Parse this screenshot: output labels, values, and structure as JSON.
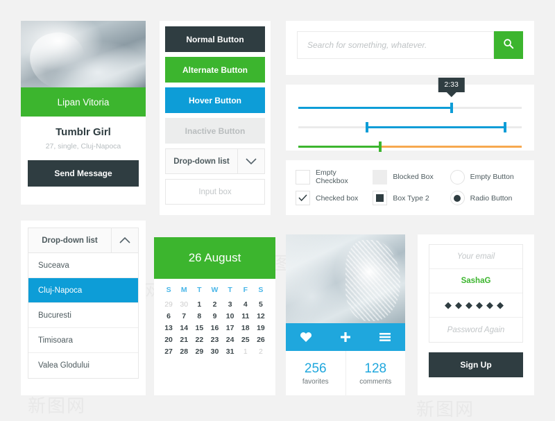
{
  "theme": {
    "page_bg": "#f2f2f2",
    "dark": "#2f3d41",
    "green": "#3cb52e",
    "blue": "#0d9dd7",
    "light_blue": "#1fa7dd",
    "orange": "#f5a council",
    "orange_fix": "#f7a84f",
    "inactive": "#eceded"
  },
  "profile_card": {
    "name_bar": "Lipan Vitoria",
    "title": "Tumblr Girl",
    "subtitle": "27, single, Cluj-Napoca",
    "button": "Send Message"
  },
  "buttons_panel": {
    "normal": "Normal Button",
    "alternate": "Alternate Button",
    "hover": "Hover Button",
    "inactive": "Inactive Button",
    "dropdown_label": "Drop-down list",
    "input_placeholder": "Input box"
  },
  "search": {
    "placeholder": "Search for something, whatever.",
    "icon": "search-icon"
  },
  "sliders": {
    "tooltip_value": "2:33",
    "items": [
      {
        "name": "single-handle-slider",
        "fill_color": "#0d9dd7",
        "start_pct": 0,
        "end_pct": 68,
        "handle_pct": 68,
        "has_tooltip": true
      },
      {
        "name": "range-slider",
        "fill_color": "#0d9dd7",
        "start_pct": 30,
        "end_pct": 92,
        "handle_pct": 30,
        "handle2_pct": 92,
        "has_tooltip": false
      },
      {
        "name": "split-color-slider",
        "fill_color": "#3cb52e",
        "second_color": "#f7a84f",
        "start_pct": 0,
        "end_pct": 36,
        "handle_pct": 36,
        "has_tooltip": false
      }
    ]
  },
  "checkboxes": [
    {
      "type": "checkbox-empty",
      "label": "Empty Checkbox"
    },
    {
      "type": "checkbox-blocked",
      "label": "Blocked Box"
    },
    {
      "type": "radio-empty",
      "label": "Empty Button"
    },
    {
      "type": "checkbox-checked",
      "label": "Checked box"
    },
    {
      "type": "checkbox-square",
      "label": "Box Type 2"
    },
    {
      "type": "radio-filled",
      "label": "Radio Button"
    }
  ],
  "dropdown_open": {
    "header": "Drop-down list",
    "options": [
      "Suceava",
      "Cluj-Napoca",
      "Bucuresti",
      "Timisoara",
      "Valea Glodului"
    ],
    "selected": "Cluj-Napoca"
  },
  "calendar": {
    "title": "26 August",
    "weekdays": [
      "S",
      "M",
      "T",
      "W",
      "T",
      "F",
      "S"
    ],
    "weeks": [
      [
        {
          "d": "29",
          "muted": true
        },
        {
          "d": "30",
          "muted": true
        },
        {
          "d": "1"
        },
        {
          "d": "2"
        },
        {
          "d": "3"
        },
        {
          "d": "4"
        },
        {
          "d": "5"
        }
      ],
      [
        {
          "d": "6"
        },
        {
          "d": "7"
        },
        {
          "d": "8"
        },
        {
          "d": "9"
        },
        {
          "d": "10"
        },
        {
          "d": "11"
        },
        {
          "d": "12"
        }
      ],
      [
        {
          "d": "13"
        },
        {
          "d": "14"
        },
        {
          "d": "15"
        },
        {
          "d": "16"
        },
        {
          "d": "17"
        },
        {
          "d": "18"
        },
        {
          "d": "19"
        }
      ],
      [
        {
          "d": "20"
        },
        {
          "d": "21"
        },
        {
          "d": "22"
        },
        {
          "d": "23"
        },
        {
          "d": "24"
        },
        {
          "d": "25"
        },
        {
          "d": "26"
        }
      ],
      [
        {
          "d": "27"
        },
        {
          "d": "28"
        },
        {
          "d": "29"
        },
        {
          "d": "30"
        },
        {
          "d": "31"
        },
        {
          "d": "1",
          "muted": true
        },
        {
          "d": "2",
          "muted": true
        }
      ]
    ]
  },
  "photo_card": {
    "actions": [
      "heart-icon",
      "plus-icon",
      "menu-icon"
    ],
    "stats": [
      {
        "value": "256",
        "caption": "favorites"
      },
      {
        "value": "128",
        "caption": "comments"
      }
    ]
  },
  "signup": {
    "email_placeholder": "Your email",
    "username_value": "SashaG",
    "password_value": "◆◆◆◆◆◆",
    "password_again_placeholder": "Password Again",
    "button": "Sign Up"
  },
  "watermarks": [
    "新图网",
    "新图网",
    "新图网",
    "新图网",
    "新图网",
    "新图网"
  ]
}
